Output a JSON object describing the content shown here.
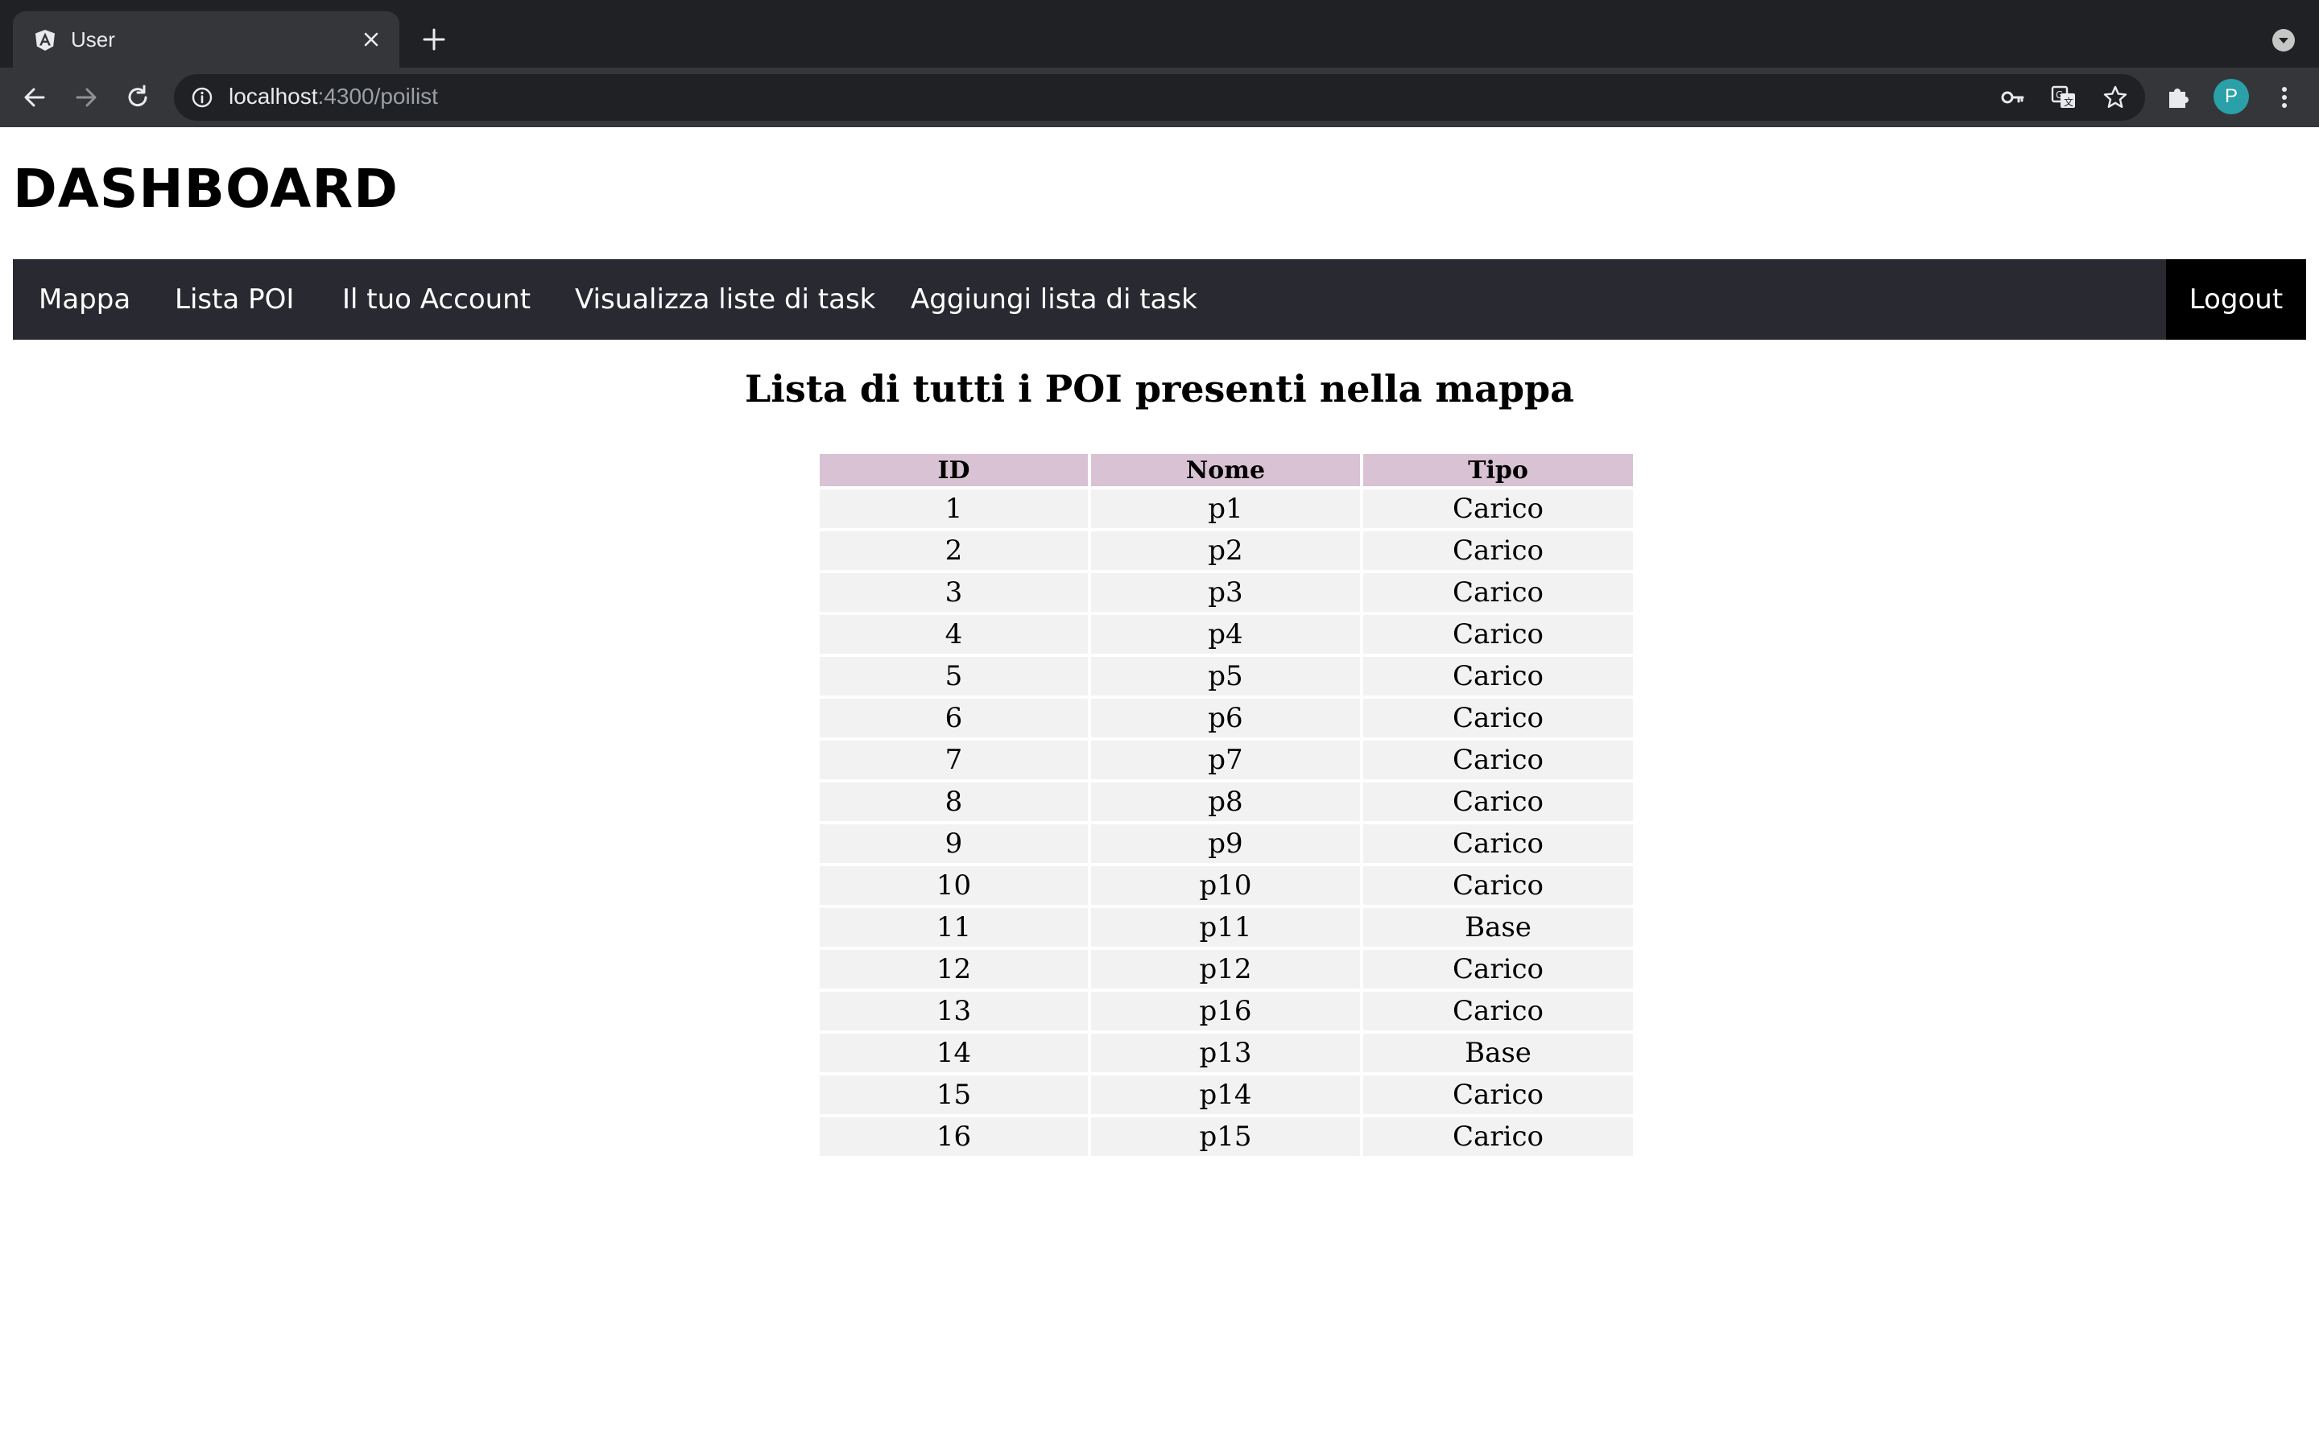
{
  "browser": {
    "tab_title": "User",
    "url_host": "localhost",
    "url_path": ":4300/poilist",
    "profile_initial": "P",
    "icons": {
      "favicon": "angular-logo-icon",
      "back": "arrow-left-icon",
      "forward": "arrow-right-icon",
      "reload": "reload-icon",
      "site_info": "info-icon",
      "password": "key-icon",
      "translate": "translate-icon",
      "bookmark": "star-icon",
      "extensions": "puzzle-icon",
      "menu": "kebab-menu-icon"
    }
  },
  "page": {
    "title": "DASHBOARD",
    "nav": {
      "items": [
        "Mappa",
        "Lista POI",
        "Il tuo Account",
        "Visualizza liste di task",
        "Aggiungi lista di task"
      ],
      "logout": "Logout"
    },
    "heading": "Lista di tutti i POI presenti nella mappa",
    "table": {
      "headers": [
        "ID",
        "Nome",
        "Tipo"
      ],
      "rows": [
        [
          "1",
          "p1",
          "Carico"
        ],
        [
          "2",
          "p2",
          "Carico"
        ],
        [
          "3",
          "p3",
          "Carico"
        ],
        [
          "4",
          "p4",
          "Carico"
        ],
        [
          "5",
          "p5",
          "Carico"
        ],
        [
          "6",
          "p6",
          "Carico"
        ],
        [
          "7",
          "p7",
          "Carico"
        ],
        [
          "8",
          "p8",
          "Carico"
        ],
        [
          "9",
          "p9",
          "Carico"
        ],
        [
          "10",
          "p10",
          "Carico"
        ],
        [
          "11",
          "p11",
          "Base"
        ],
        [
          "12",
          "p12",
          "Carico"
        ],
        [
          "13",
          "p16",
          "Carico"
        ],
        [
          "14",
          "p13",
          "Base"
        ],
        [
          "15",
          "p14",
          "Carico"
        ],
        [
          "16",
          "p15",
          "Carico"
        ]
      ]
    }
  },
  "colors": {
    "navbar": "#292a31",
    "logout_bg": "#000000",
    "table_header": "#d8c2d3",
    "table_cell": "#f2f2f2"
  }
}
